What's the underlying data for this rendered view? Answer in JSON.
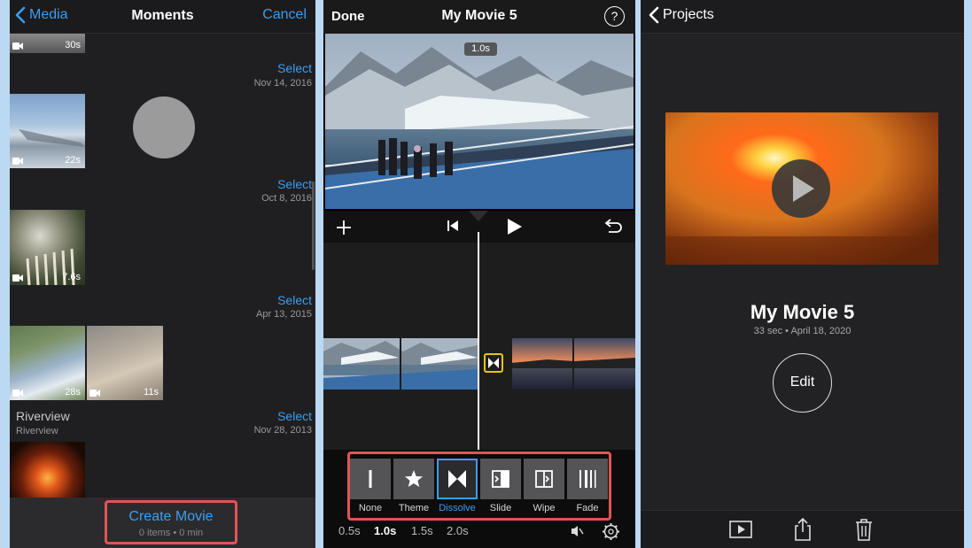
{
  "moments": {
    "back_label": "Media",
    "title": "Moments",
    "cancel_label": "Cancel",
    "select_label": "Select",
    "groups": [
      {
        "date": "Nov 14, 2016",
        "durations": [
          "30s",
          "22s"
        ]
      },
      {
        "date": "Oct 8, 2016",
        "durations": [
          "7.6s"
        ]
      },
      {
        "date": "Apr 13, 2015",
        "durations": [
          "28s",
          "11s"
        ]
      },
      {
        "date": "Nov 28, 2013",
        "title": "Riverview",
        "subtitle": "Riverview",
        "durations": []
      }
    ],
    "create_movie": {
      "label": "Create Movie",
      "summary": "0 items • 0 min"
    }
  },
  "editor": {
    "done_label": "Done",
    "title": "My Movie 5",
    "help_label": "?",
    "preview_badge": "1.0s",
    "transitions": [
      {
        "label": "None",
        "icon": "bar-icon"
      },
      {
        "label": "Theme",
        "icon": "star-icon"
      },
      {
        "label": "Dissolve",
        "icon": "dissolve-icon",
        "active": true
      },
      {
        "label": "Slide",
        "icon": "slide-icon"
      },
      {
        "label": "Wipe",
        "icon": "wipe-icon"
      },
      {
        "label": "Fade",
        "icon": "fade-icon"
      }
    ],
    "durations": [
      "0.5s",
      "1.0s",
      "1.5s",
      "2.0s"
    ],
    "selected_duration": "1.0s",
    "accent": "#3c9ef0",
    "highlight": "#e25454",
    "transition_marker_color": "#e9c21a"
  },
  "projects": {
    "back_label": "Projects",
    "movie_title": "My Movie 5",
    "movie_meta": "33 sec • April 18, 2020",
    "edit_label": "Edit",
    "toolbar": [
      "play-icon",
      "share-icon",
      "trash-icon"
    ]
  }
}
